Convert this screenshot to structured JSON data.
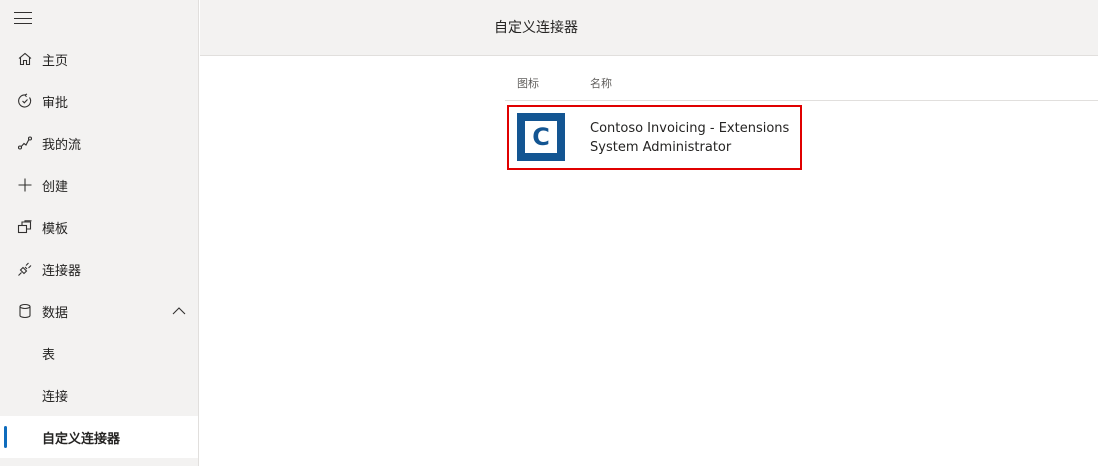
{
  "sidebar": {
    "items": [
      {
        "label": "主页",
        "icon": "home-icon"
      },
      {
        "label": "审批",
        "icon": "approvals-icon"
      },
      {
        "label": "我的流",
        "icon": "flow-icon"
      },
      {
        "label": "创建",
        "icon": "plus-icon"
      },
      {
        "label": "模板",
        "icon": "templates-icon"
      },
      {
        "label": "连接器",
        "icon": "connector-icon"
      },
      {
        "label": "数据",
        "icon": "database-icon",
        "expanded": true
      }
    ],
    "data_subitems": [
      {
        "label": "表"
      },
      {
        "label": "连接"
      },
      {
        "label": "自定义连接器",
        "active": true
      }
    ]
  },
  "header": {
    "title": "自定义连接器"
  },
  "table": {
    "columns": {
      "icon": "图标",
      "name": "名称"
    },
    "rows": [
      {
        "logo_letter": "C",
        "name": "Contoso Invoicing - Extensions",
        "owner": "System Administrator"
      }
    ]
  },
  "colors": {
    "accent": "#0f6cbd",
    "logo": "#135592",
    "highlight": "#e00000"
  }
}
